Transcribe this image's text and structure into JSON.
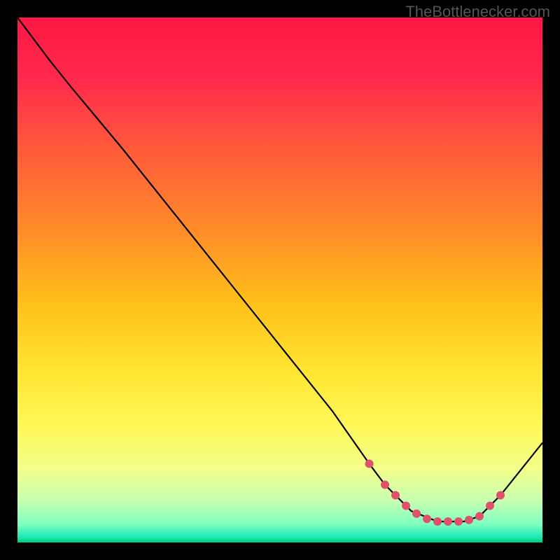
{
  "watermark": "TheBottlenecker.com",
  "chart_data": {
    "type": "line",
    "title": "",
    "xlabel": "",
    "ylabel": "",
    "xlim": [
      0,
      100
    ],
    "ylim": [
      0,
      100
    ],
    "curve": {
      "x": [
        0,
        6,
        10,
        20,
        30,
        40,
        50,
        60,
        67,
        70,
        75,
        80,
        85,
        88,
        92,
        100
      ],
      "y": [
        100,
        92,
        87,
        75,
        62.5,
        50,
        37.5,
        25,
        15,
        11,
        6,
        4,
        4,
        5,
        9,
        19
      ]
    },
    "markers": {
      "x": [
        67,
        70,
        72,
        74,
        76,
        78,
        80,
        82,
        84,
        86,
        88,
        90,
        92
      ],
      "y": [
        15,
        11,
        9,
        7,
        5.5,
        4.5,
        4,
        4,
        4,
        4.3,
        5,
        7,
        9
      ]
    },
    "gradient_stops": [
      {
        "pos": 0.0,
        "color": "#ff1744"
      },
      {
        "pos": 0.12,
        "color": "#ff2a4d"
      },
      {
        "pos": 0.25,
        "color": "#ff5a3a"
      },
      {
        "pos": 0.4,
        "color": "#ff8a2a"
      },
      {
        "pos": 0.55,
        "color": "#ffc21a"
      },
      {
        "pos": 0.68,
        "color": "#ffe733"
      },
      {
        "pos": 0.78,
        "color": "#fff85a"
      },
      {
        "pos": 0.86,
        "color": "#f2ff8a"
      },
      {
        "pos": 0.92,
        "color": "#c8ffb0"
      },
      {
        "pos": 0.965,
        "color": "#7fffc0"
      },
      {
        "pos": 0.99,
        "color": "#1de9b6"
      },
      {
        "pos": 1.0,
        "color": "#00c97b"
      }
    ],
    "marker_color": "#e0526b",
    "line_color": "#000000"
  }
}
